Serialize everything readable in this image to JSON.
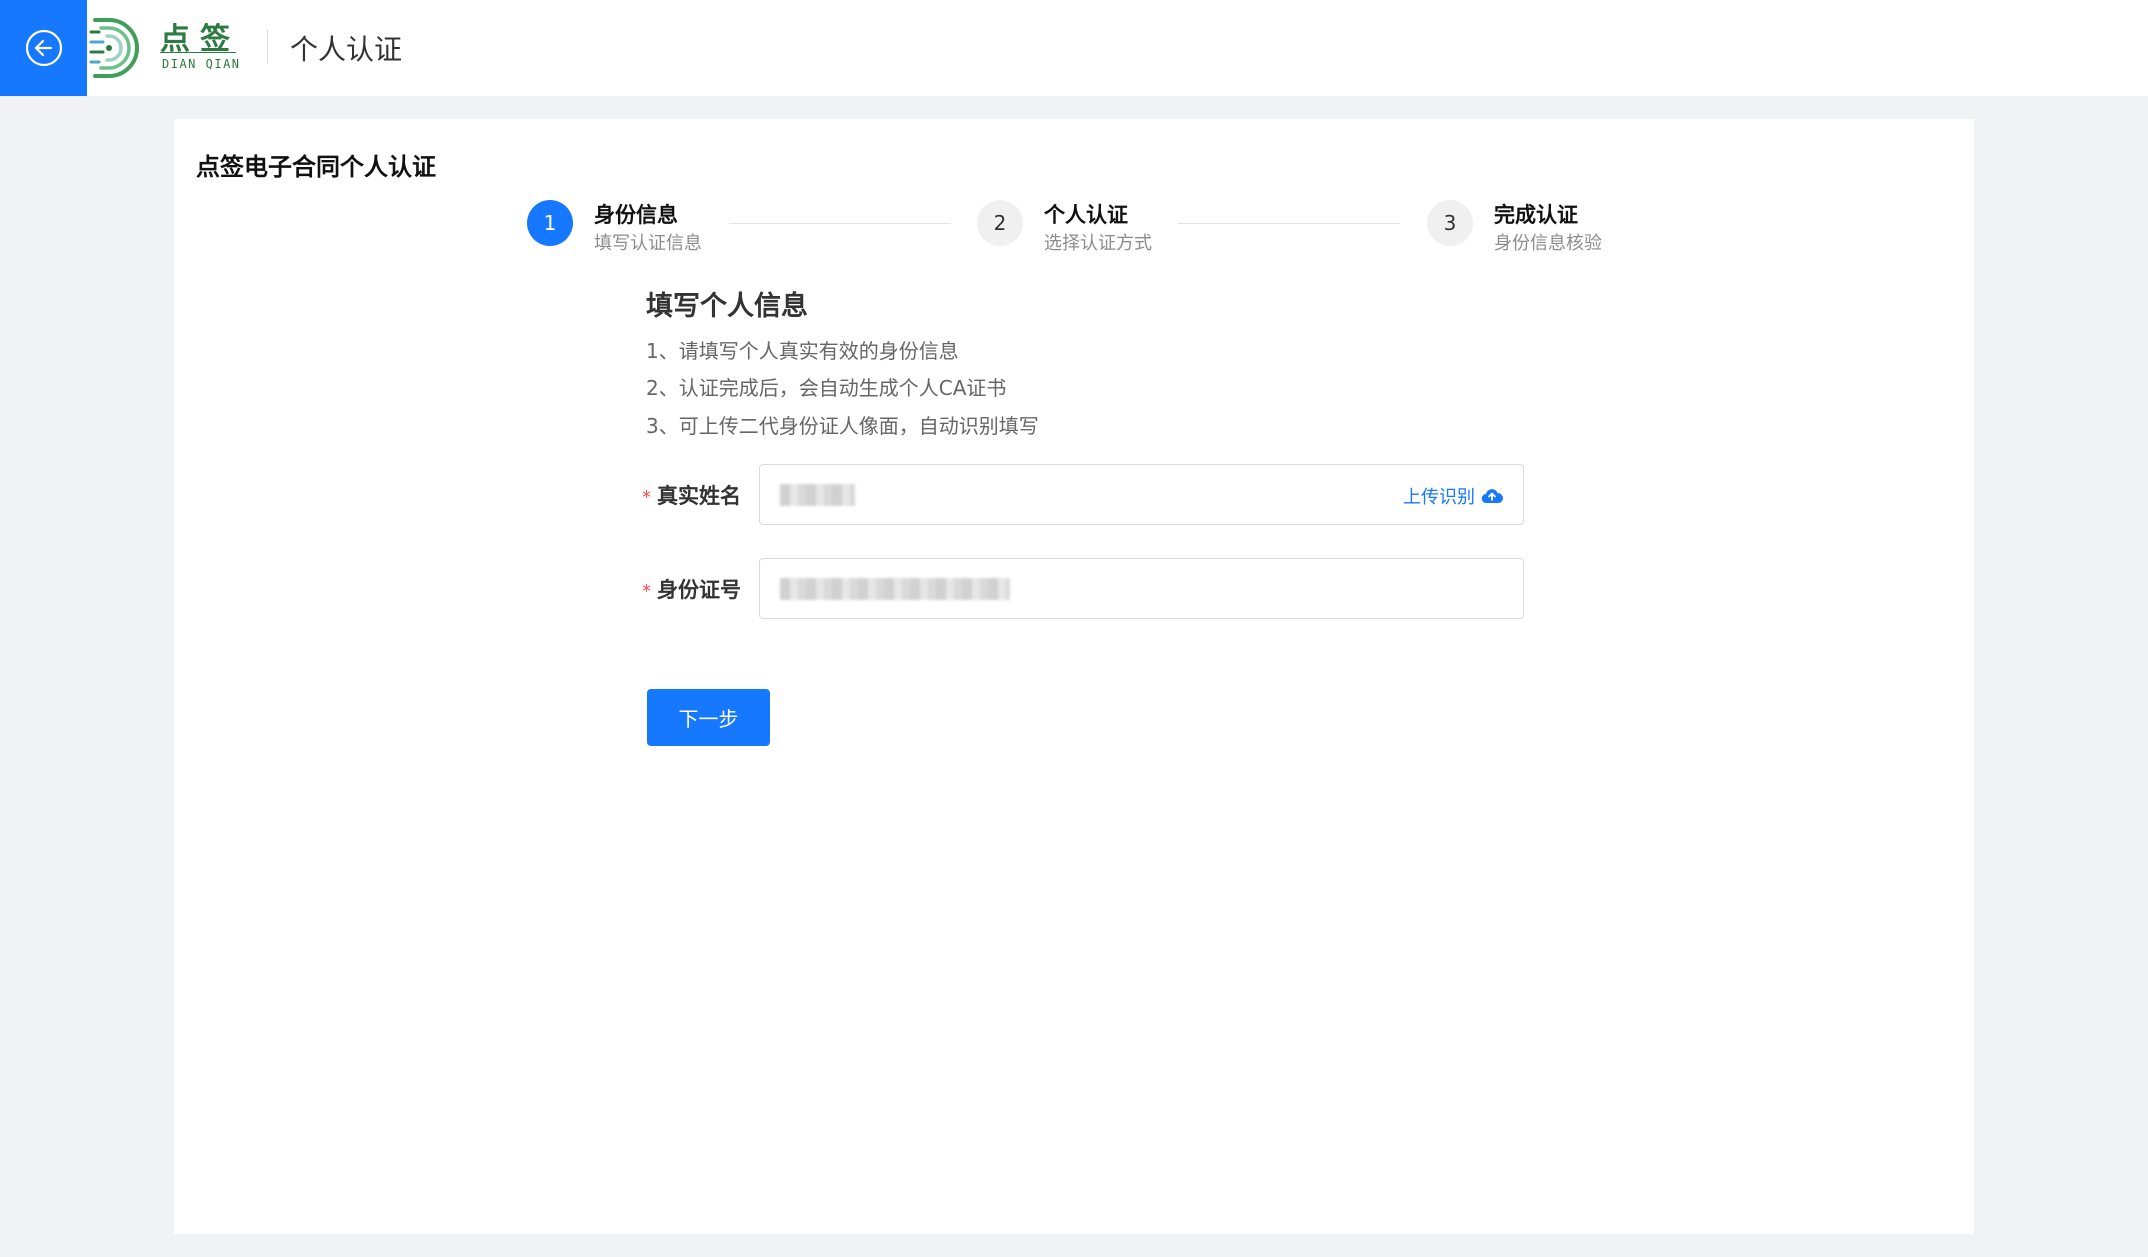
{
  "header": {
    "logo_cn": "点签",
    "logo_en": "DIAN QIAN",
    "title": "个人认证"
  },
  "card": {
    "title": "点签电子合同个人认证"
  },
  "steps": [
    {
      "number": "1",
      "title": "身份信息",
      "desc": "填写认证信息",
      "status": "active"
    },
    {
      "number": "2",
      "title": "个人认证",
      "desc": "选择认证方式",
      "status": "wait"
    },
    {
      "number": "3",
      "title": "完成认证",
      "desc": "身份信息核验",
      "status": "wait"
    }
  ],
  "form": {
    "section_title": "填写个人信息",
    "tips": [
      "1、请填写个人真实有效的身份信息",
      "2、认证完成后，会自动生成个人CA证书",
      "3、可上传二代身份证人像面，自动识别填写"
    ],
    "name_label": "真实姓名",
    "id_label": "身份证号",
    "required_mark": "*",
    "upload_label": "上传识别",
    "next_label": "下一步"
  },
  "colors": {
    "primary": "#1677ff",
    "brand_green": "#2b7a3f",
    "required": "#ff4d4f"
  }
}
